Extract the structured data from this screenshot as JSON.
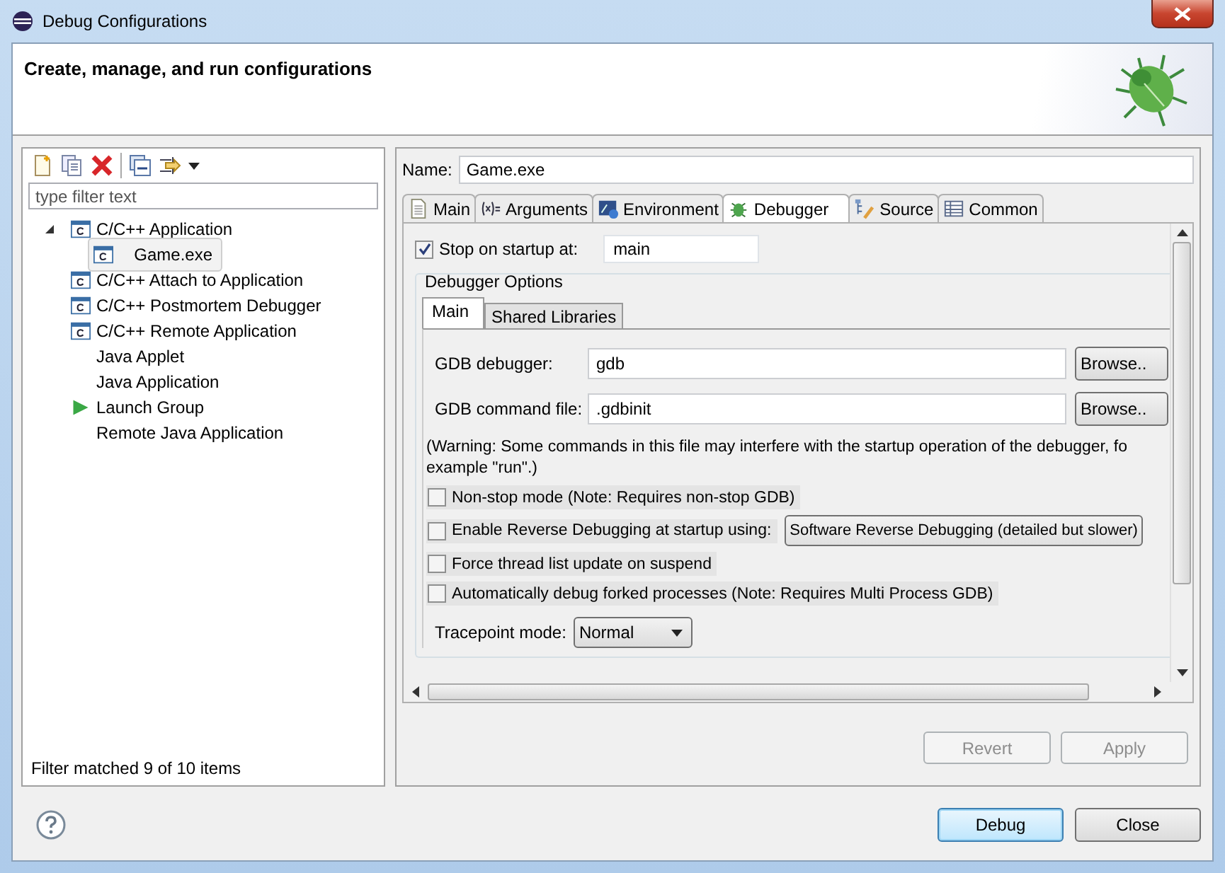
{
  "window": {
    "title": "Debug Configurations"
  },
  "header": {
    "title": "Create, manage, and run configurations"
  },
  "filter": {
    "placeholder": "type filter text"
  },
  "tree": [
    {
      "label": "C/C++ Application",
      "kind": "c",
      "expanded": true,
      "selected": false,
      "children": [
        {
          "label": "Game.exe",
          "kind": "c",
          "selected": true
        }
      ]
    },
    {
      "label": "C/C++ Attach to Application",
      "kind": "c",
      "expanded": false,
      "selected": false
    },
    {
      "label": "C/C++ Postmortem Debugger",
      "kind": "c",
      "expanded": false,
      "selected": false
    },
    {
      "label": "C/C++ Remote Application",
      "kind": "c",
      "expanded": false,
      "selected": false
    },
    {
      "label": "Java Applet",
      "kind": "plain",
      "expanded": false,
      "selected": false
    },
    {
      "label": "Java Application",
      "kind": "plain",
      "expanded": false,
      "selected": false
    },
    {
      "label": "Launch Group",
      "kind": "launch",
      "expanded": false,
      "selected": false
    },
    {
      "label": "Remote Java Application",
      "kind": "plain",
      "expanded": false,
      "selected": false
    }
  ],
  "status": "Filter matched 9 of 10 items",
  "name": {
    "label": "Name:",
    "value": "Game.exe"
  },
  "tabs": [
    {
      "label": "Main",
      "kind": "main",
      "selected": false
    },
    {
      "label": "Arguments",
      "kind": "arguments",
      "selected": false
    },
    {
      "label": "Environment",
      "kind": "environment",
      "selected": false
    },
    {
      "label": "Debugger",
      "kind": "debugger",
      "selected": true
    },
    {
      "label": "Source",
      "kind": "source",
      "selected": false
    },
    {
      "label": "Common",
      "kind": "common",
      "selected": false
    }
  ],
  "stop_on_startup": {
    "label": "Stop on startup at:",
    "checked": true,
    "value": "main"
  },
  "debugger_options": {
    "title": "Debugger Options",
    "tabs": [
      {
        "label": "Main",
        "selected": true
      },
      {
        "label": "Shared Libraries",
        "selected": false
      }
    ],
    "fields": [
      {
        "label": "GDB debugger:",
        "value": "gdb",
        "button": "Browse.."
      },
      {
        "label": "GDB command file:",
        "value": ".gdbinit",
        "button": "Browse.."
      }
    ],
    "warning": "(Warning: Some commands in this file may interfere with the startup operation of the debugger, fo\nexample \"run\".)",
    "options": [
      {
        "label": "Non-stop mode (Note: Requires non-stop GDB)",
        "checked": false
      },
      {
        "label": "Enable Reverse Debugging at startup using:",
        "checked": false,
        "choice": "Software Reverse Debugging (detailed but slower)"
      },
      {
        "label": "Force thread list update on suspend",
        "checked": false
      },
      {
        "label": "Automatically debug forked processes (Note: Requires Multi Process GDB)",
        "checked": false
      }
    ],
    "tracepoint": {
      "label": "Tracepoint mode:",
      "value": "Normal"
    }
  },
  "actions": [
    {
      "label": "Revert",
      "disabled": true
    },
    {
      "label": "Apply",
      "disabled": true
    }
  ],
  "buttons": [
    {
      "label": "Debug",
      "default": true
    },
    {
      "label": "Close",
      "default": false
    }
  ]
}
